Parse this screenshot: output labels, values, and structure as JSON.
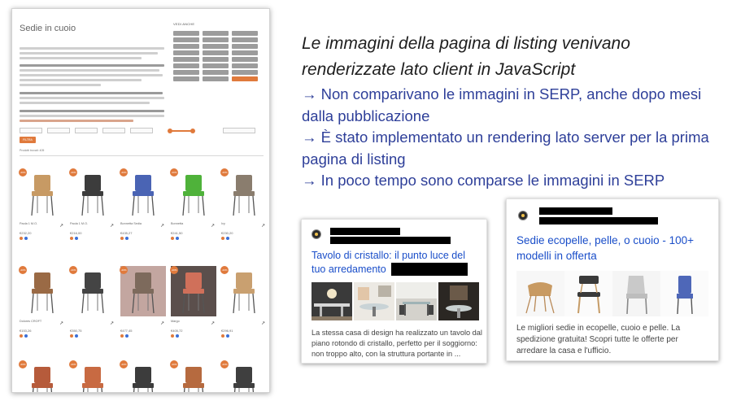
{
  "listing": {
    "title": "Sedie in cuoio",
    "filter_heading": "VEDI ANCHE",
    "tags": [
      "",
      "",
      "",
      "",
      "",
      "",
      "",
      "",
      "",
      "",
      "",
      "",
      "",
      "",
      "",
      "",
      "",
      "",
      "",
      "",
      "",
      "",
      "",
      ""
    ],
    "filter_button": "FILTRA",
    "results": "Prodotti trovati: 405",
    "products": [
      {
        "name": "Paola 1 M.O.",
        "price": "€232,20",
        "old": "",
        "ship": "",
        "badge": "-20%"
      },
      {
        "name": "Paola 1 M.O.",
        "price": "€216,00",
        "old": "",
        "ship": "",
        "badge": "-20%"
      },
      {
        "name": "Bonnetta Sedia",
        "price": "€435,27",
        "old": "",
        "ship": "",
        "badge": "-20%"
      },
      {
        "name": "Bonnetta",
        "price": "€241,50",
        "old": "",
        "ship": "",
        "badge": "-20%"
      },
      {
        "name": "Ivy",
        "price": "€230,20",
        "old": "",
        "ship": "",
        "badge": "-20%"
      },
      {
        "name": "Dolores CROFT",
        "price": "€153,26",
        "old": "",
        "ship": "",
        "badge": "-20%"
      },
      {
        "name": "",
        "price": "€350,75",
        "old": "",
        "ship": "",
        "badge": "-20%"
      },
      {
        "name": "",
        "price": "€477,45",
        "old": "",
        "ship": "",
        "badge": "-20%"
      },
      {
        "name": "Margo",
        "price": "€405,72",
        "old": "",
        "ship": "",
        "badge": "-20%"
      },
      {
        "name": "",
        "price": "€296,91",
        "old": "",
        "ship": "",
        "badge": "-20%"
      },
      {
        "name": "",
        "price": "",
        "old": "",
        "ship": "",
        "badge": "-20%"
      },
      {
        "name": "",
        "price": "",
        "old": "",
        "ship": "",
        "badge": "-20%"
      },
      {
        "name": "",
        "price": "",
        "old": "",
        "ship": "",
        "badge": "-20%"
      },
      {
        "name": "",
        "price": "",
        "old": "",
        "ship": "",
        "badge": "-20%"
      },
      {
        "name": "",
        "price": "",
        "old": "",
        "ship": "",
        "badge": "-20%"
      }
    ],
    "colors": {
      "accent": "#e07a3c",
      "tag": "#9c9c9c"
    }
  },
  "slide": {
    "title_line1": "Le immagini della pagina di listing venivano",
    "title_line2": "renderizzate lato client in JavaScript",
    "bullets": [
      "→ Non comparivano le immagini in SERP, anche dopo mesi dalla pubblicazione",
      "→ È stato implementato un rendering lato server per la prima pagina di listing",
      "→ In poco tempo sono comparse le immagini in SERP"
    ],
    "title_color": "#1e1e1e",
    "bullet_color": "#2e3f99"
  },
  "serp1": {
    "title_line1": "Tavolo di cristallo: il punto luce del",
    "title_line2": "tuo arredamento",
    "snippet": [
      "La stessa casa di design ha realizzato un tavolo dal",
      "piano rotondo di cristallo, perfetto per il soggiorno:",
      "non troppo alto, con la struttura portante in ..."
    ]
  },
  "serp2": {
    "title_line1": "Sedie ecopelle, pelle, o cuoio - 100+",
    "title_line2": "modelli in offerta",
    "snippet": [
      "Le migliori sedie in ecopelle, cuoio e pelle. La",
      "spedizione gratuita! Scopri tutte le offerte per",
      "arredare la casa e l'ufficio."
    ],
    "link_color": "#1a4ec9"
  }
}
